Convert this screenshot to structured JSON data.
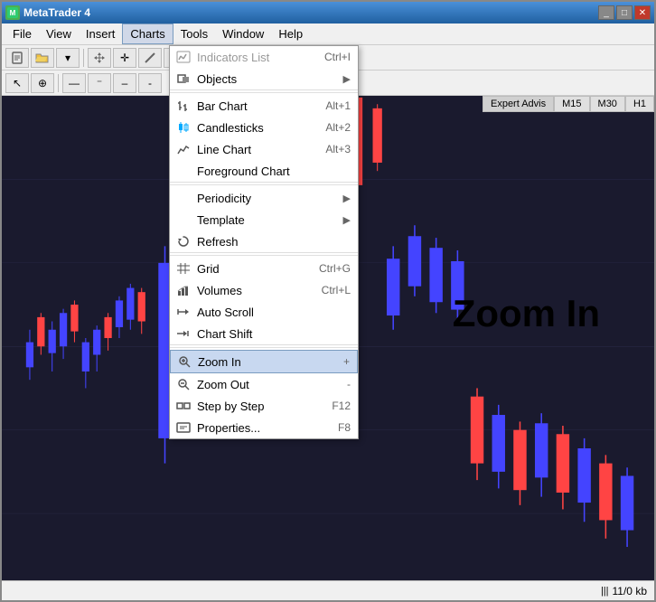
{
  "window": {
    "title": "MetaTrader 4",
    "icon": "MT"
  },
  "menubar": {
    "items": [
      "File",
      "View",
      "Insert",
      "Charts",
      "Tools",
      "Window",
      "Help"
    ]
  },
  "menu_active": "Charts",
  "dropdown": {
    "items": [
      {
        "id": "indicators",
        "label": "Indicators List",
        "shortcut": "Ctrl+I",
        "icon": "list",
        "arrow": false,
        "disabled": false,
        "section": 1
      },
      {
        "id": "objects",
        "label": "Objects",
        "shortcut": "",
        "icon": "obj",
        "arrow": true,
        "disabled": false,
        "section": 1
      },
      {
        "id": "bar-chart",
        "label": "Bar Chart",
        "shortcut": "Alt+1",
        "icon": "bar",
        "arrow": false,
        "disabled": false,
        "section": 2
      },
      {
        "id": "candlesticks",
        "label": "Candlesticks",
        "shortcut": "Alt+2",
        "icon": "candle",
        "arrow": false,
        "disabled": false,
        "section": 2
      },
      {
        "id": "line-chart",
        "label": "Line Chart",
        "shortcut": "Alt+3",
        "icon": "line",
        "arrow": false,
        "disabled": false,
        "section": 2
      },
      {
        "id": "foreground-chart",
        "label": "Foreground Chart",
        "shortcut": "",
        "icon": "fg",
        "arrow": false,
        "disabled": false,
        "section": 2
      },
      {
        "id": "periodicity",
        "label": "Periodicity",
        "shortcut": "",
        "icon": "",
        "arrow": true,
        "disabled": false,
        "section": 3
      },
      {
        "id": "template",
        "label": "Template",
        "shortcut": "",
        "icon": "",
        "arrow": true,
        "disabled": false,
        "section": 3
      },
      {
        "id": "refresh",
        "label": "Refresh",
        "shortcut": "",
        "icon": "refresh",
        "arrow": false,
        "disabled": false,
        "section": 3
      },
      {
        "id": "grid",
        "label": "Grid",
        "shortcut": "Ctrl+G",
        "icon": "grid",
        "arrow": false,
        "disabled": false,
        "section": 4
      },
      {
        "id": "volumes",
        "label": "Volumes",
        "shortcut": "Ctrl+L",
        "icon": "vol",
        "arrow": false,
        "disabled": false,
        "section": 4
      },
      {
        "id": "auto-scroll",
        "label": "Auto Scroll",
        "shortcut": "",
        "icon": "autoscroll",
        "arrow": false,
        "disabled": false,
        "section": 4
      },
      {
        "id": "chart-shift",
        "label": "Chart Shift",
        "shortcut": "",
        "icon": "shift",
        "arrow": false,
        "disabled": false,
        "section": 4
      },
      {
        "id": "zoom-in",
        "label": "Zoom In",
        "shortcut": "+",
        "icon": "zoomin",
        "arrow": false,
        "disabled": false,
        "section": 5,
        "highlighted": true
      },
      {
        "id": "zoom-out",
        "label": "Zoom Out",
        "shortcut": "-",
        "icon": "zoomout",
        "arrow": false,
        "disabled": false,
        "section": 5
      },
      {
        "id": "step-by-step",
        "label": "Step by Step",
        "shortcut": "F12",
        "icon": "step",
        "arrow": false,
        "disabled": false,
        "section": 5
      },
      {
        "id": "properties",
        "label": "Properties...",
        "shortcut": "F8",
        "icon": "props",
        "arrow": false,
        "disabled": false,
        "section": 5
      }
    ]
  },
  "chart": {
    "tabs": [
      "M15",
      "M30",
      "H1"
    ],
    "zoom_label": "Zoom In"
  },
  "statusbar": {
    "info": "11/0 kb",
    "icon": "|||"
  },
  "chart_tabs_label": "Expert Advis"
}
